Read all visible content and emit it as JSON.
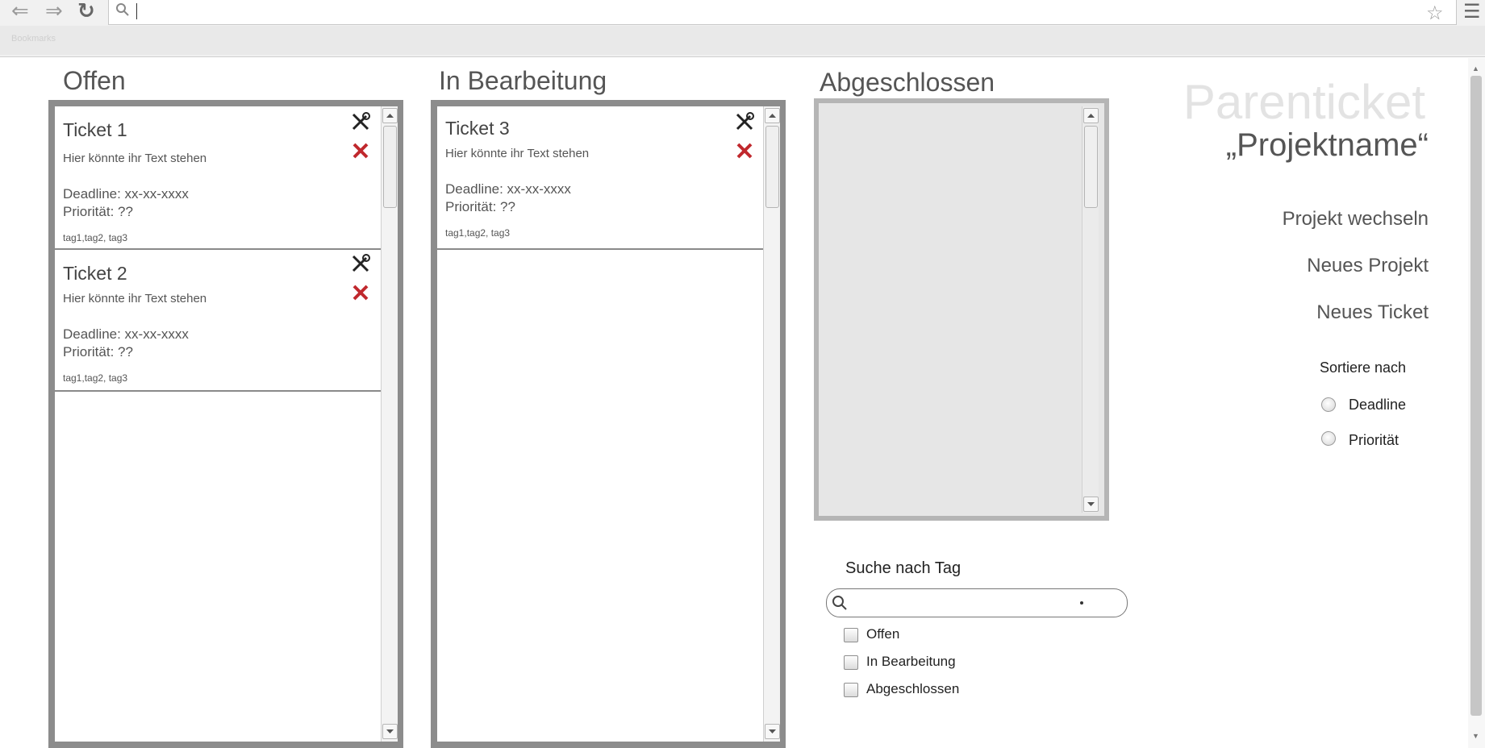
{
  "browser": {
    "back": "⇐",
    "forward": "⇒",
    "reload": "↻",
    "search_glyph": "search-icon",
    "star_glyph": "☆",
    "menu_glyph": "☰",
    "bookmark_text": "Bookmarks"
  },
  "columns": {
    "offen": {
      "title": "Offen",
      "tickets": [
        {
          "title": "Ticket 1",
          "text": "Hier könnte ihr Text stehen",
          "deadline": "Deadline: xx-xx-xxxx",
          "priority": "Priorität: ??",
          "tags": "tag1,tag2, tag3"
        },
        {
          "title": "Ticket 2",
          "text": "Hier könnte ihr Text stehen",
          "deadline": "Deadline: xx-xx-xxxx",
          "priority": "Priorität: ??",
          "tags": "tag1,tag2, tag3"
        }
      ]
    },
    "in_bearbeitung": {
      "title": "In Bearbeitung",
      "tickets": [
        {
          "title": "Ticket 3",
          "text": "Hier könnte ihr Text stehen",
          "deadline": "Deadline: xx-xx-xxxx",
          "priority": "Priorität: ??",
          "tags": "tag1,tag2, tag3"
        }
      ]
    },
    "abgeschlossen": {
      "title": "Abgeschlossen",
      "tickets": []
    }
  },
  "right_panel": {
    "title": "Parenticket",
    "project_name": "„Projektname“",
    "links": [
      "Projekt wechseln",
      "Neues Projekt",
      "Neues Ticket"
    ],
    "sort_label": "Sortiere nach",
    "sort_options": [
      "Deadline",
      "Priorität"
    ]
  },
  "search": {
    "label": "Suche nach Tag",
    "placeholder": "",
    "value": "",
    "filters": [
      "Offen",
      "In Bearbeitung",
      "Abgeschlossen"
    ]
  },
  "colors": {
    "accent_delete": "#c0282d",
    "column_border": "#8c8c8c",
    "done_bg": "#e6e6e6"
  }
}
